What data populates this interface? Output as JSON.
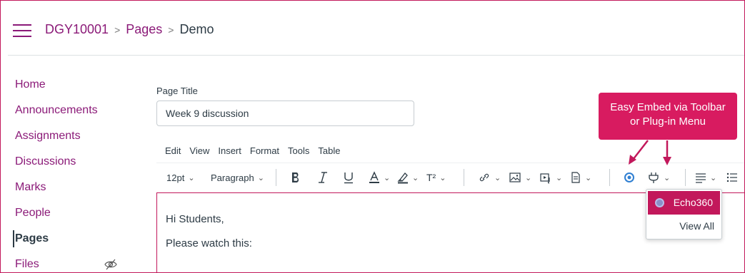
{
  "breadcrumb": {
    "course": "DGY10001",
    "section": "Pages",
    "current": "Demo",
    "separator": ">"
  },
  "sidebar": {
    "items": [
      {
        "label": "Home"
      },
      {
        "label": "Announcements"
      },
      {
        "label": "Assignments"
      },
      {
        "label": "Discussions"
      },
      {
        "label": "Marks"
      },
      {
        "label": "People"
      },
      {
        "label": "Pages",
        "active": true
      },
      {
        "label": "Files",
        "hidden_icon": "eye-off-icon"
      }
    ]
  },
  "page_title": {
    "label": "Page Title",
    "value": "Week 9 discussion"
  },
  "editor": {
    "menubar": [
      "Edit",
      "View",
      "Insert",
      "Format",
      "Tools",
      "Table"
    ],
    "toolbar": {
      "font_size": "12pt",
      "block_format": "Paragraph",
      "superscript_label": "T²",
      "icons": [
        "bold-icon",
        "italic-icon",
        "underline-icon",
        "text-color-icon",
        "highlight-icon",
        "superscript-icon",
        "link-icon",
        "image-icon",
        "media-icon",
        "document-icon",
        "echo360-icon",
        "plugin-icon",
        "align-icon",
        "list-icon"
      ]
    },
    "content": [
      "Hi Students,",
      "Please watch this:"
    ]
  },
  "callout": {
    "line1": "Easy Embed via Toolbar",
    "line2": "or Plug-in Menu"
  },
  "plugin_menu": {
    "items": [
      "Echo360",
      "View All"
    ]
  },
  "colors": {
    "brand": "#8b1a78",
    "accent": "#c2185b",
    "callout": "#d81b60",
    "text": "#2d3b45"
  }
}
